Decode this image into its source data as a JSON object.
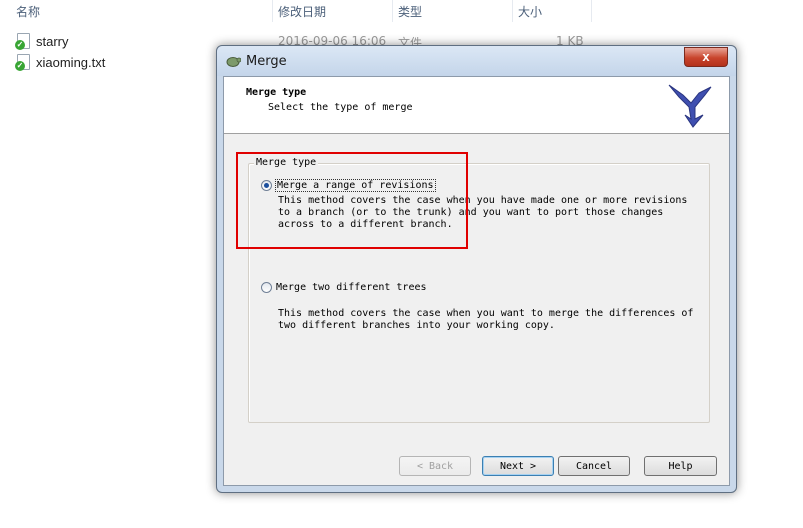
{
  "explorer": {
    "columns": [
      "名称",
      "修改日期",
      "类型",
      "大小"
    ],
    "files": [
      {
        "name": "starry",
        "date": "2016-09-06 16:06",
        "type": "文件",
        "size": "1 KB"
      },
      {
        "name": "xiaoming.txt",
        "date": "",
        "type": "",
        "size": ""
      }
    ]
  },
  "dialog": {
    "title": "Merge",
    "close_glyph": "x",
    "header": {
      "title": "Merge type",
      "subtitle": "Select the type of merge"
    },
    "group_label": "Merge type",
    "options": [
      {
        "label": "Merge a range of revisions",
        "selected": true,
        "description": "This method covers the case when you have made one or more revisions\nto a branch (or to the trunk) and you want to port those changes\nacross to a different branch."
      },
      {
        "label": "Merge two different trees",
        "selected": false,
        "description": "This method covers the case when you want to merge the differences of\ntwo different branches into your working copy."
      }
    ],
    "buttons": {
      "back": "< Back",
      "next": "Next >",
      "cancel": "Cancel",
      "help": "Help"
    },
    "colors": {
      "highlight": "#e00000",
      "logo": "#3f4fb0"
    }
  }
}
